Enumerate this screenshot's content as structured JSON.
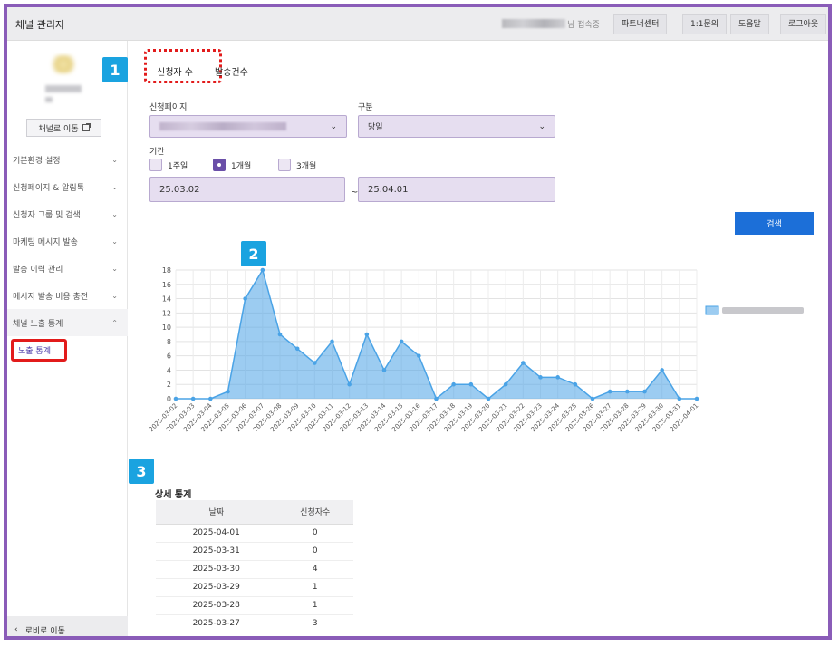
{
  "topbar": {
    "app_title": "채널 관리자",
    "user_suffix": "님 접속중",
    "buttons": [
      "파트너센터",
      "1:1문의",
      "도움말",
      "로그아웃"
    ]
  },
  "sidebar": {
    "channel_button": "채널로 이동",
    "menu": [
      {
        "label": "기본환경 설정",
        "chevron": "⌄"
      },
      {
        "label": "신청페이지 & 알림톡",
        "chevron": "⌄"
      },
      {
        "label": "신청자 그룹 및 검색",
        "chevron": "⌄"
      },
      {
        "label": "마케팅 메시지 발송",
        "chevron": "⌄"
      },
      {
        "label": "발송 이력 관리",
        "chevron": "⌄"
      },
      {
        "label": "메시지 발송 비용 충전",
        "chevron": "⌄"
      },
      {
        "label": "채널 노출 통계",
        "chevron": "⌃"
      }
    ],
    "submenu_active": "노출 통계",
    "back_label": "로비로 이동",
    "back_chevron": "‹"
  },
  "annotations": {
    "badge1": "1",
    "badge2": "2",
    "badge3": "3"
  },
  "tabs": {
    "tab1": "신청자 수",
    "tab2": "발송건수"
  },
  "filters": {
    "page_label": "신청페이지",
    "type_label": "구분",
    "type_value": "당일",
    "period_label": "기간",
    "radios": [
      {
        "label": "1주일",
        "checked": false
      },
      {
        "label": "1개월",
        "checked": true
      },
      {
        "label": "3개월",
        "checked": false
      }
    ],
    "start_date": "25.03.02",
    "tilde": "~",
    "end_date": "25.04.01",
    "search_button": "검색"
  },
  "chart_data": {
    "type": "area",
    "categories": [
      "2025-03-02",
      "2025-03-03",
      "2025-03-04",
      "2025-03-05",
      "2025-03-06",
      "2025-03-07",
      "2025-03-08",
      "2025-03-09",
      "2025-03-10",
      "2025-03-11",
      "2025-03-12",
      "2025-03-13",
      "2025-03-14",
      "2025-03-15",
      "2025-03-16",
      "2025-03-17",
      "2025-03-18",
      "2025-03-19",
      "2025-03-20",
      "2025-03-21",
      "2025-03-22",
      "2025-03-23",
      "2025-03-24",
      "2025-03-25",
      "2025-03-26",
      "2025-03-27",
      "2025-03-28",
      "2025-03-29",
      "2025-03-30",
      "2025-03-31",
      "2025-04-01"
    ],
    "values": [
      0,
      0,
      0,
      1,
      14,
      18,
      9,
      7,
      5,
      8,
      2,
      9,
      4,
      8,
      6,
      0,
      2,
      2,
      0,
      2,
      5,
      3,
      3,
      2,
      0,
      1,
      1,
      1,
      4,
      0,
      0
    ],
    "ylim": [
      0,
      18
    ],
    "yticks": [
      0,
      2,
      4,
      6,
      8,
      10,
      12,
      14,
      16,
      18
    ],
    "grid": true,
    "legend_position": "top-right",
    "color": "#4aa3e6"
  },
  "stats": {
    "title": "상세 통계",
    "headers": [
      "날짜",
      "신청자수"
    ],
    "rows": [
      [
        "2025-04-01",
        "0"
      ],
      [
        "2025-03-31",
        "0"
      ],
      [
        "2025-03-30",
        "4"
      ],
      [
        "2025-03-29",
        "1"
      ],
      [
        "2025-03-28",
        "1"
      ],
      [
        "2025-03-27",
        "3"
      ]
    ]
  }
}
